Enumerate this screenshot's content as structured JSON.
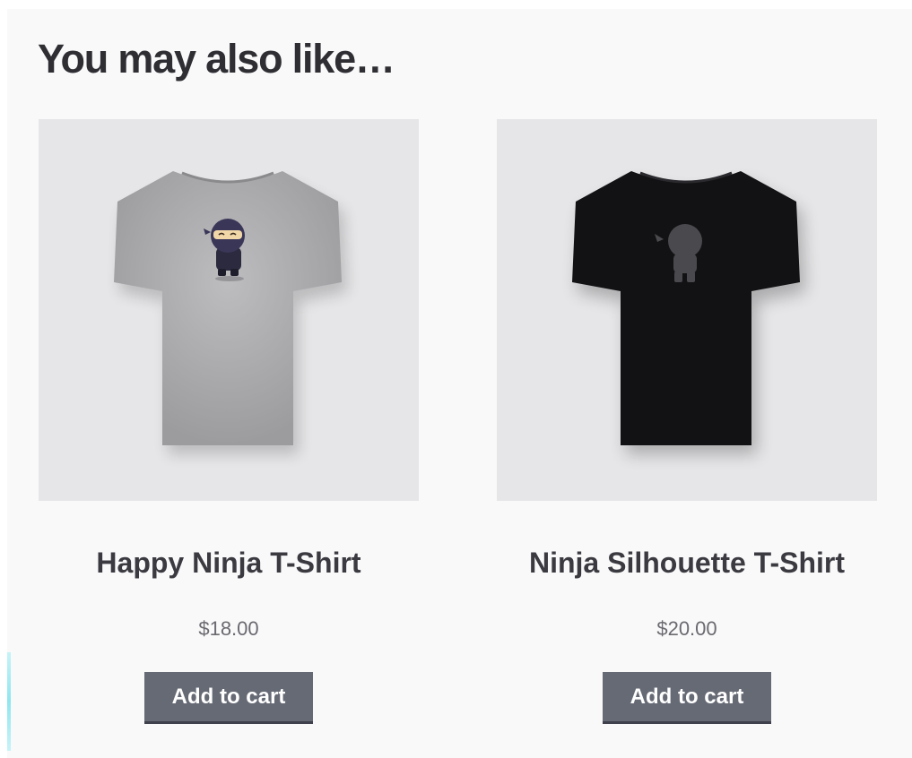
{
  "section": {
    "title": "You may also like…"
  },
  "products": [
    {
      "name": "Happy Ninja T-Shirt",
      "price": "$18.00",
      "button_label": "Add to cart",
      "shirt_color": "#a9a9ab",
      "image_alt": "Happy Ninja T-Shirt"
    },
    {
      "name": "Ninja Silhouette T-Shirt",
      "price": "$20.00",
      "button_label": "Add to cart",
      "shirt_color": "#121214",
      "image_alt": "Ninja Silhouette T-Shirt"
    }
  ],
  "colors": {
    "background": "#f9f9fa",
    "image_background": "#e6e6e8",
    "button": "#666a75",
    "title_text": "#2e2e33"
  }
}
